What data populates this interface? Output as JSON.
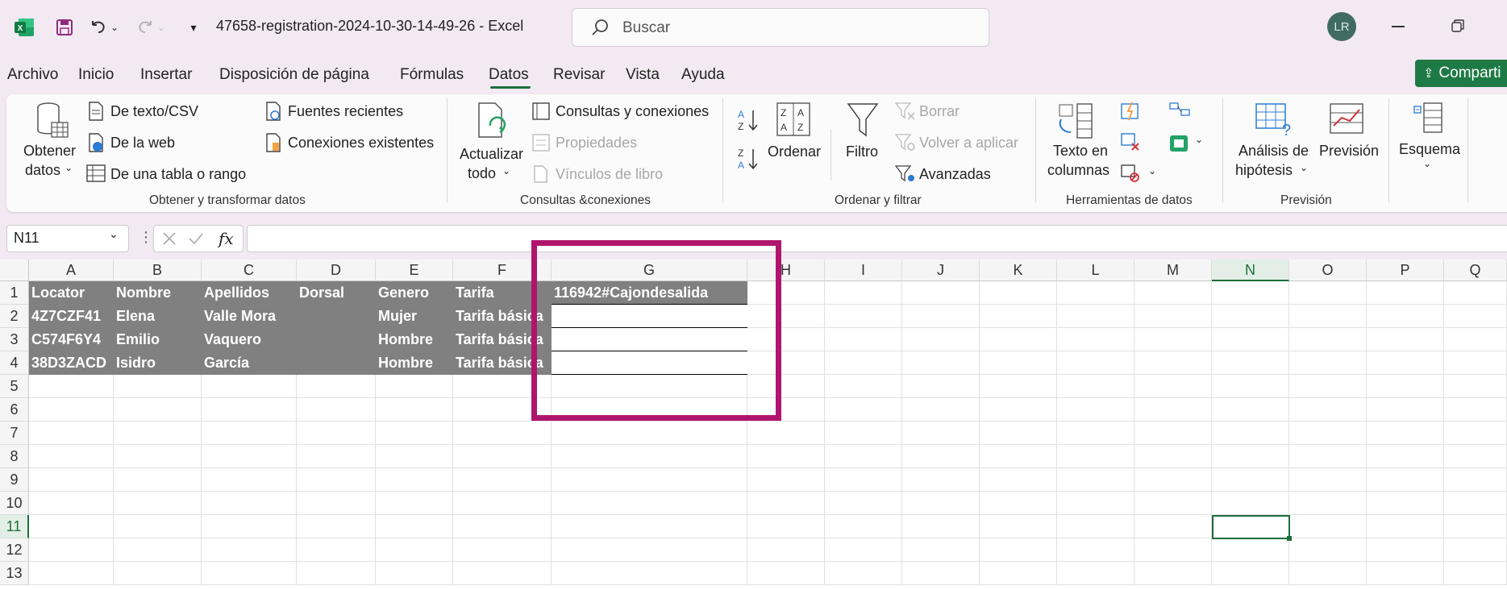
{
  "app": {
    "doc_title": "47658-registration-2024-10-30-14-49-26  -  Excel",
    "search_placeholder": "Buscar",
    "avatar_initials": "LR"
  },
  "menu": {
    "items": [
      "Archivo",
      "Inicio",
      "Insertar",
      "Disposición de página",
      "Fórmulas",
      "Datos",
      "Revisar",
      "Vista",
      "Ayuda"
    ],
    "active": "Datos",
    "share_label": "Comparti"
  },
  "ribbon": {
    "obtener": {
      "get_data": [
        "Obtener",
        "datos"
      ],
      "from_text": "De texto/CSV",
      "from_web": "De la web",
      "from_table": "De una tabla o rango",
      "recent_sources": "Fuentes recientes",
      "existing_connections": "Conexiones existentes",
      "label": "Obtener y transformar datos"
    },
    "consultas": {
      "refresh_all": [
        "Actualizar",
        "todo"
      ],
      "queries_connections": "Consultas y conexiones",
      "properties": "Propiedades",
      "book_links": "Vínculos de libro",
      "label": "Consultas &conexiones"
    },
    "ordenar": {
      "sort": "Ordenar",
      "filter": "Filtro",
      "clear": "Borrar",
      "reapply": "Volver a aplicar",
      "advanced": "Avanzadas",
      "label": "Ordenar y filtrar"
    },
    "herramientas": {
      "text_to_columns": [
        "Texto en",
        "columnas"
      ],
      "label": "Herramientas de datos"
    },
    "prevision": {
      "whatif": [
        "Análisis de",
        "hipótesis"
      ],
      "forecast": "Previsión",
      "label": "Previsión"
    },
    "esquema": {
      "outline": "Esquema"
    }
  },
  "formula_bar": {
    "name_box": "N11",
    "fx": "fx",
    "formula": ""
  },
  "sheet": {
    "columns": [
      "A",
      "B",
      "C",
      "D",
      "E",
      "F",
      "G",
      "H",
      "I",
      "J",
      "K",
      "L",
      "M",
      "N",
      "O",
      "P",
      "Q"
    ],
    "rows": [
      "1",
      "2",
      "3",
      "4",
      "5",
      "6",
      "7",
      "8",
      "9",
      "10",
      "11",
      "12",
      "13"
    ],
    "selected_column": "N",
    "selected_row": "11",
    "table": [
      [
        "Locator",
        "Nombre",
        "Apellidos",
        "Dorsal",
        "Genero",
        "Tarifa",
        "116942#Cajondesalida"
      ],
      [
        "4Z7CZF41",
        "Elena",
        "Valle Mora",
        "",
        "Mujer",
        "Tarifa básica",
        ""
      ],
      [
        "C574F6Y4",
        "Emilio",
        "Vaquero",
        "",
        "Hombre",
        "Tarifa básica",
        ""
      ],
      [
        "38D3ZACD",
        "Isidro",
        "García",
        "",
        "Hombre",
        "Tarifa básica",
        ""
      ]
    ]
  },
  "colors": {
    "accent_green": "#1e6e3b",
    "highlight_magenta": "#b0156d",
    "table_fill": "#808080"
  }
}
